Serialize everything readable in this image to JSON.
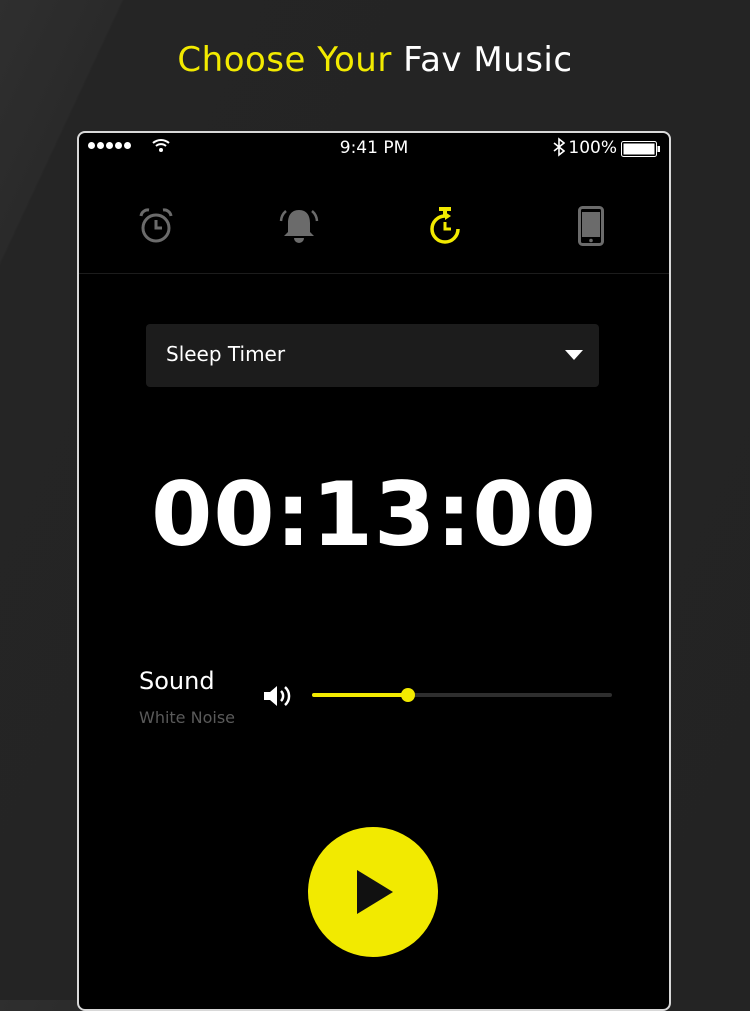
{
  "header": {
    "accent_text": "Choose Your",
    "rest_text": " Fav Music"
  },
  "status_bar": {
    "time": "9:41 PM",
    "battery_text": "100%"
  },
  "tabs": [
    {
      "icon": "alarm-clock-icon",
      "active": false
    },
    {
      "icon": "bell-icon",
      "active": false
    },
    {
      "icon": "timer-icon",
      "active": true
    },
    {
      "icon": "phone-icon",
      "active": false
    }
  ],
  "timer_select": {
    "selected": "Sleep Timer"
  },
  "countdown": "00:13:00",
  "sound": {
    "title": "Sound",
    "subtitle": "White Noise",
    "volume_fraction": 0.32
  },
  "colors": {
    "accent": "#f2ea00",
    "background": "#000000",
    "inactive_icon": "#6b6b6b"
  }
}
